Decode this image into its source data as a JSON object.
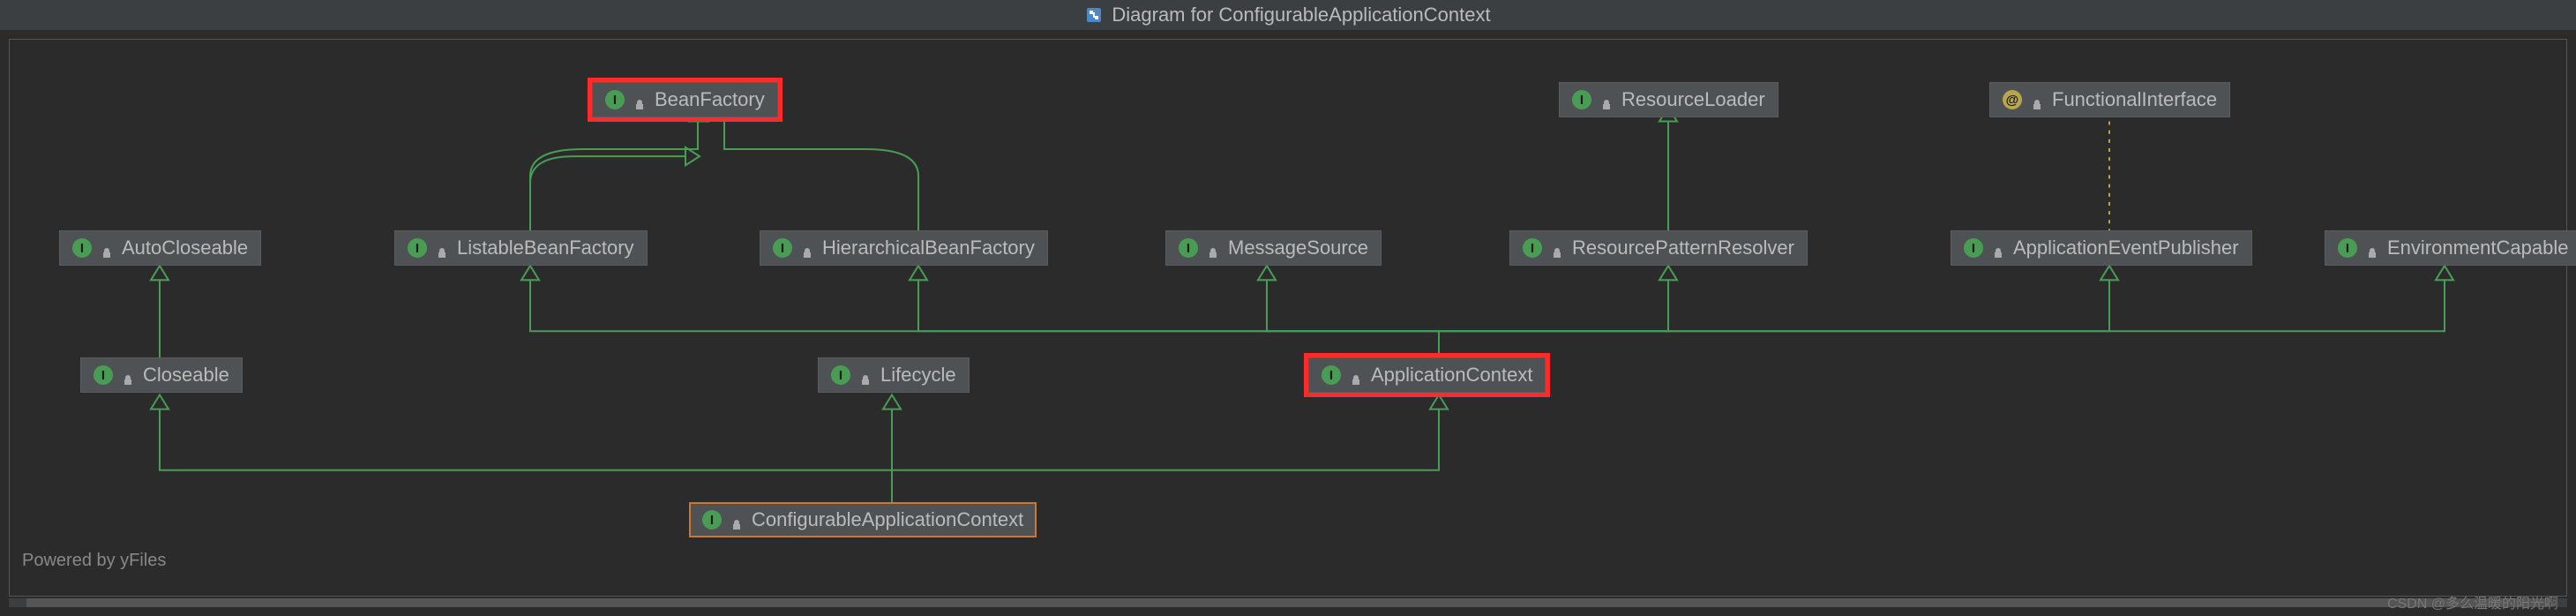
{
  "title": "Diagram for ConfigurableApplicationContext",
  "footer": "Powered by yFiles",
  "watermark": "CSDN @多么温暖的阳光啊",
  "nodes": {
    "beanFactory": {
      "label": "BeanFactory",
      "badge": "I"
    },
    "resourceLoader": {
      "label": "ResourceLoader",
      "badge": "I"
    },
    "functionalInterface": {
      "label": "FunctionalInterface",
      "badge": "@"
    },
    "autoCloseable": {
      "label": "AutoCloseable",
      "badge": "I"
    },
    "listableBeanFactory": {
      "label": "ListableBeanFactory",
      "badge": "I"
    },
    "hierarchicalBeanFactory": {
      "label": "HierarchicalBeanFactory",
      "badge": "I"
    },
    "messageSource": {
      "label": "MessageSource",
      "badge": "I"
    },
    "resourcePatternResolver": {
      "label": "ResourcePatternResolver",
      "badge": "I"
    },
    "applicationEventPublisher": {
      "label": "ApplicationEventPublisher",
      "badge": "I"
    },
    "environmentCapable": {
      "label": "EnvironmentCapable",
      "badge": "I"
    },
    "closeable": {
      "label": "Closeable",
      "badge": "I"
    },
    "lifecycle": {
      "label": "Lifecycle",
      "badge": "I"
    },
    "applicationContext": {
      "label": "ApplicationContext",
      "badge": "I"
    },
    "configurableApplicationContext": {
      "label": "ConfigurableApplicationContext",
      "badge": "I"
    }
  }
}
